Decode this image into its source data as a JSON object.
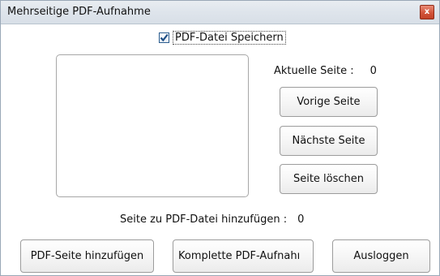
{
  "window": {
    "title": "Mehrseitige PDF-Aufnahme",
    "close_glyph": "x"
  },
  "save_pdf": {
    "label": "PDF-Datei Speichern",
    "checked": true
  },
  "current_page": {
    "label": "Aktuelle Seite :",
    "value": "0"
  },
  "side_buttons": {
    "previous": "Vorige Seite",
    "next": "Nächste Seite",
    "delete": "Seite löschen"
  },
  "add_to_pdf": {
    "label": "Seite zu PDF-Datei hinzufügen :",
    "value": "0"
  },
  "bottom_buttons": {
    "add_page": "PDF-Seite hinzufügen",
    "complete": "Komplette PDF-Aufnahı",
    "logout": "Ausloggen"
  },
  "colors": {
    "accent_check": "#2b5d8f",
    "close_button": "#d2543a"
  }
}
